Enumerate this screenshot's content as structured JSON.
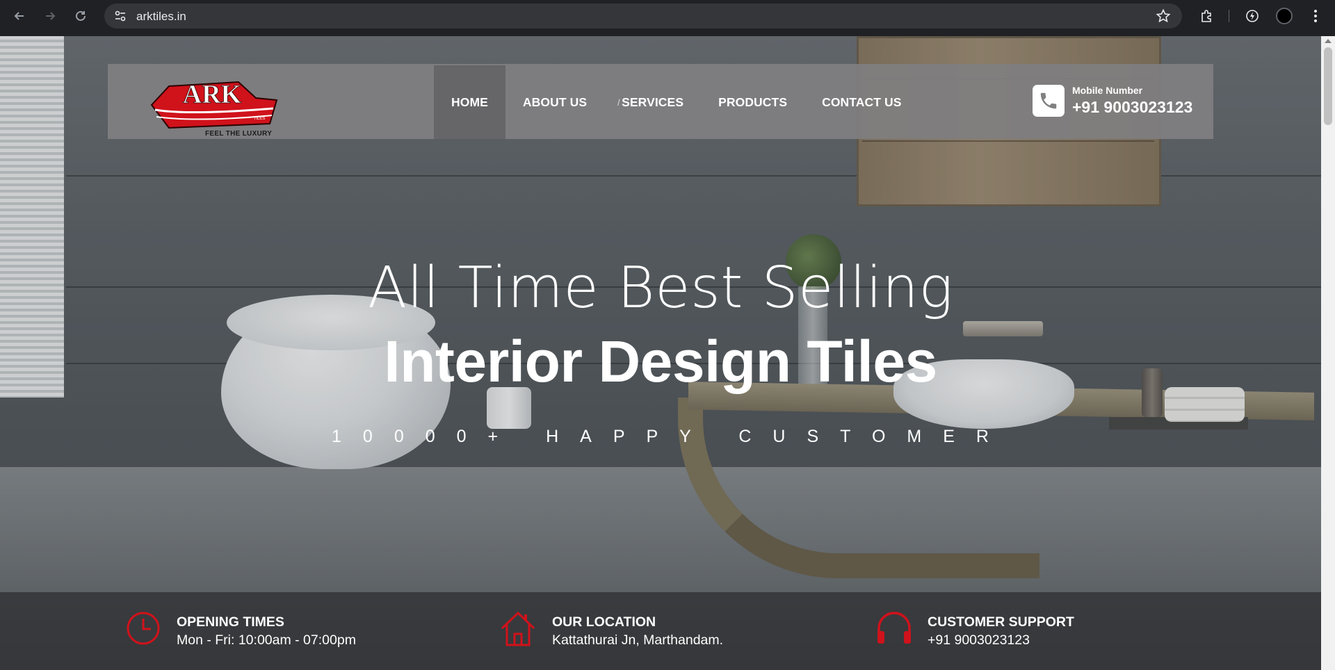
{
  "browser": {
    "url": "arktiles.in",
    "back_icon": "arrow-left-icon",
    "forward_icon": "arrow-right-icon",
    "reload_icon": "reload-icon",
    "site_info_icon": "tune-icon",
    "bookmark_icon": "star-icon",
    "extensions_icon": "puzzle-icon",
    "performance_icon": "leaf-bolt-icon",
    "menu_icon": "kebab-icon"
  },
  "header": {
    "logo_text": "ARK",
    "logo_small": "TILES",
    "logo_tagline": "FEEL THE LUXURY",
    "nav": [
      {
        "label": "HOME",
        "active": true
      },
      {
        "label": "ABOUT US",
        "active": false
      },
      {
        "label": "SERVICES",
        "active": false
      },
      {
        "label": "PRODUCTS",
        "active": false
      },
      {
        "label": "CONTACT US",
        "active": false
      }
    ],
    "contact_label": "Mobile Number",
    "contact_number": "+91 9003023123",
    "contact_icon": "phone-icon"
  },
  "hero": {
    "line1": "All Time Best Selling",
    "line2": "Interior Design Tiles",
    "line3": "10000+ HAPPY CUSTOMER"
  },
  "info": [
    {
      "icon": "clock-icon",
      "title": "OPENING TIMES",
      "text": "Mon - Fri: 10:00am - 07:00pm"
    },
    {
      "icon": "home-icon",
      "title": "OUR LOCATION",
      "text": "Kattathurai Jn, Marthandam."
    },
    {
      "icon": "headphones-icon",
      "title": "CUSTOMER SUPPORT",
      "text": "+91 9003023123"
    }
  ],
  "colors": {
    "accent_red": "#d0121b",
    "header_bg": "#807e80",
    "active_nav_bg": "#666567",
    "chrome_bg": "#202124"
  }
}
